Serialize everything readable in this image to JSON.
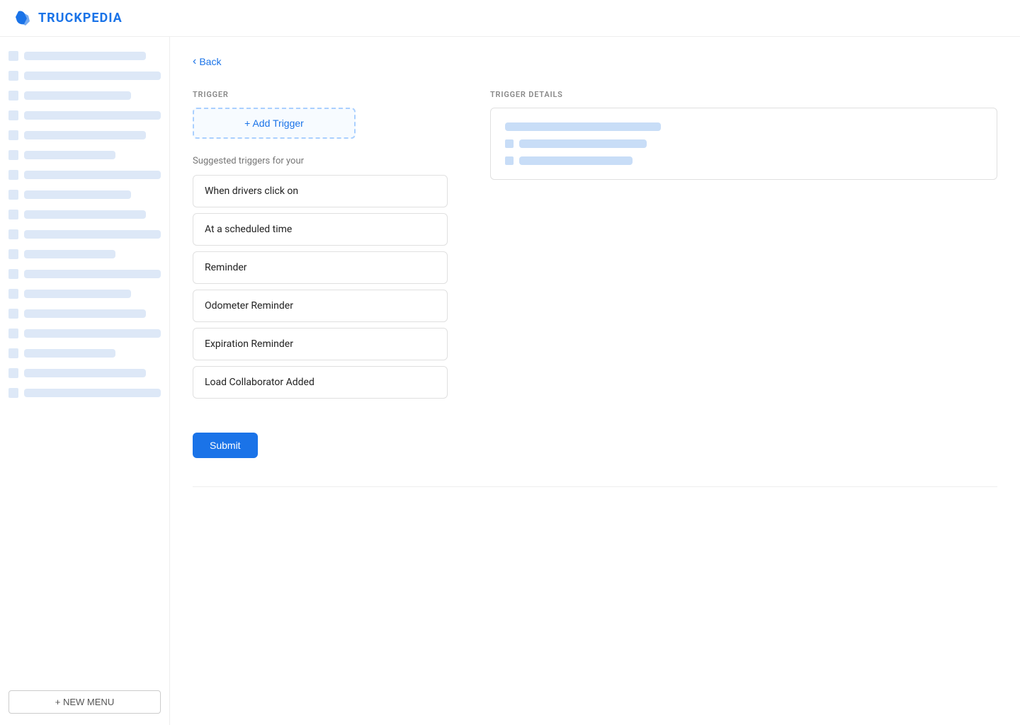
{
  "header": {
    "logo_text": "TRUCKPEDIA",
    "logo_icon_alt": "truckpedia-logo"
  },
  "sidebar": {
    "new_menu_label": "+ NEW MENU",
    "skeleton_rows": 18
  },
  "back_button": {
    "label": "Back"
  },
  "trigger_section": {
    "label": "TRIGGER",
    "add_trigger_label": "+ Add Trigger",
    "suggested_label": "Suggested triggers for your",
    "items": [
      {
        "id": "when-drivers-click-on",
        "label": "When drivers click on"
      },
      {
        "id": "at-a-scheduled-time",
        "label": "At a scheduled time"
      },
      {
        "id": "reminder",
        "label": "Reminder"
      },
      {
        "id": "odometer-reminder",
        "label": "Odometer Reminder"
      },
      {
        "id": "expiration-reminder",
        "label": "Expiration Reminder"
      },
      {
        "id": "load-collaborator-added",
        "label": "Load Collaborator Added"
      }
    ]
  },
  "trigger_details_section": {
    "label": "TRIGGER DETAILS"
  },
  "submit_button": {
    "label": "Submit"
  },
  "colors": {
    "brand_blue": "#1a73e8",
    "skeleton_light": "#dde8f7",
    "skeleton_medium": "#c8ddf7"
  }
}
